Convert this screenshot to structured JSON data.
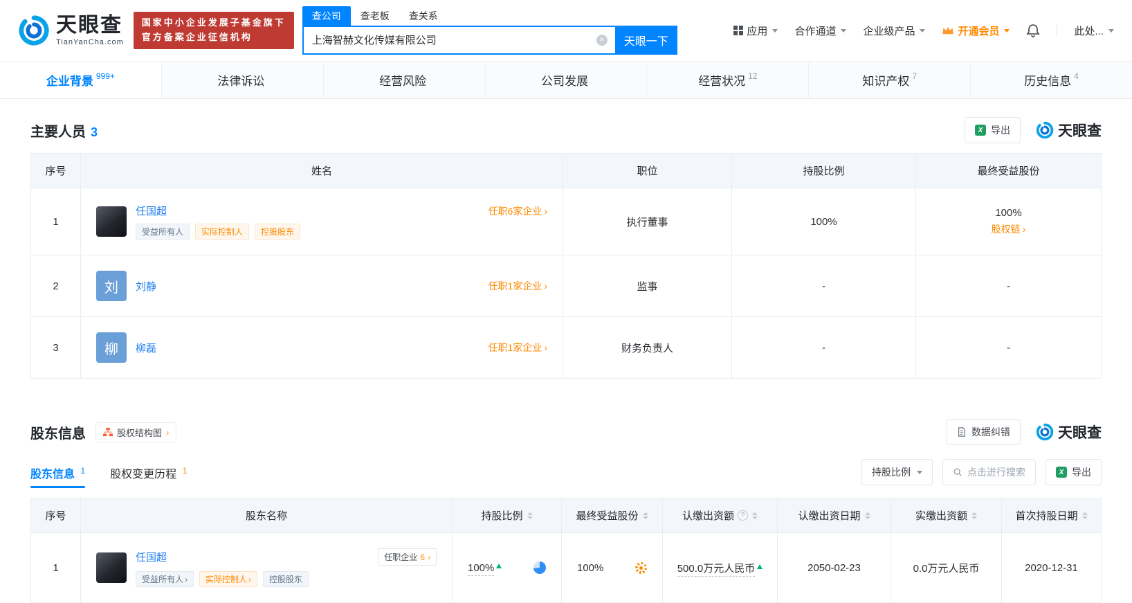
{
  "header": {
    "brand": {
      "name": "天眼查",
      "domain": "TianYanCha.com"
    },
    "badge": {
      "line1": "国家中小企业发展子基金旗下",
      "line2": "官方备案企业征信机构"
    },
    "search": {
      "tabs": [
        {
          "label": "查公司"
        },
        {
          "label": "查老板"
        },
        {
          "label": "查关系"
        }
      ],
      "value": "上海智赫文化传媒有限公司",
      "button": "天眼一下"
    },
    "nav": {
      "apps": "应用",
      "partner": "合作通道",
      "enterprise": "企业级产品",
      "vip": "开通会员",
      "user": "此处..."
    }
  },
  "page_tabs": [
    {
      "label": "企业背景",
      "count": "999+"
    },
    {
      "label": "法律诉讼",
      "count": ""
    },
    {
      "label": "经营风险",
      "count": ""
    },
    {
      "label": "公司发展",
      "count": ""
    },
    {
      "label": "经营状况",
      "count": "12"
    },
    {
      "label": "知识产权",
      "count": "7"
    },
    {
      "label": "历史信息",
      "count": "4"
    }
  ],
  "staff": {
    "title": "主要人员",
    "count": "3",
    "export": "导出",
    "brand": "天眼查",
    "headers": {
      "index": "序号",
      "name": "姓名",
      "position": "职位",
      "ratio": "持股比例",
      "benefit": "最终受益股份"
    },
    "rows": [
      {
        "index": "1",
        "name": "任国超",
        "tag1": "受益所有人",
        "tag2": "实际控制人",
        "tag3": "控股股东",
        "link": "任职6家企业",
        "position": "执行董事",
        "ratio": "100%",
        "benefit": "100%",
        "benefit_link": "股权链"
      },
      {
        "index": "2",
        "name": "刘静",
        "avatar": "刘",
        "link": "任职1家企业",
        "position": "监事",
        "ratio": "-",
        "benefit": "-"
      },
      {
        "index": "3",
        "name": "柳磊",
        "avatar": "柳",
        "link": "任职1家企业",
        "position": "财务负责人",
        "ratio": "-",
        "benefit": "-"
      }
    ]
  },
  "shareholders": {
    "title": "股东信息",
    "structure_btn": "股权结构图",
    "correction_btn": "数据纠错",
    "brand": "天眼查",
    "tab1": {
      "label": "股东信息",
      "count": "1"
    },
    "tab2": {
      "label": "股权变更历程",
      "count": "1"
    },
    "filter": "持股比例",
    "search_placeholder": "点击进行搜索",
    "export": "导出",
    "headers": {
      "index": "序号",
      "name": "股东名称",
      "ratio": "持股比例",
      "benefit": "最终受益股份",
      "subscribed": "认缴出资额",
      "subscribed_date": "认缴出资日期",
      "paid": "实缴出资额",
      "first_date": "首次持股日期"
    },
    "row": {
      "index": "1",
      "name": "任国超",
      "tag1": "受益所有人",
      "tag2": "实际控制人",
      "tag3": "控股股东",
      "positions_label": "任职企业",
      "positions_count": "6",
      "ratio": "100%",
      "benefit": "100%",
      "subscribed": "500.0万元人民币",
      "subscribed_date": "2050-02-23",
      "paid": "0.0万元人民币",
      "first_date": "2020-12-31"
    }
  }
}
